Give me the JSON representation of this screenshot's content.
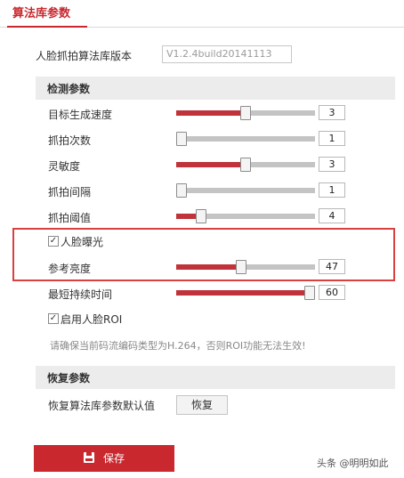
{
  "tab": {
    "label": "算法库参数"
  },
  "version": {
    "label": "人脸抓拍算法库版本",
    "value": "V1.2.4build20141113"
  },
  "detect_section": {
    "title": "检测参数"
  },
  "sliders": [
    {
      "label": "目标生成速度",
      "value": "3",
      "percent": 50
    },
    {
      "label": "抓拍次数",
      "value": "1",
      "percent": 4
    },
    {
      "label": "灵敏度",
      "value": "3",
      "percent": 50
    },
    {
      "label": "抓拍间隔",
      "value": "1",
      "percent": 4
    },
    {
      "label": "抓拍阈值",
      "value": "4",
      "percent": 18
    }
  ],
  "face_exposure": {
    "label": "人脸曝光",
    "checked": true
  },
  "brightness": {
    "label": "参考亮度",
    "value": "47",
    "percent": 47
  },
  "min_duration": {
    "label": "最短持续时间",
    "value": "60",
    "percent": 96
  },
  "face_roi": {
    "label": "启用人脸ROI",
    "checked": true
  },
  "hint": "请确保当前码流编码类型为H.264，否则ROI功能无法生效!",
  "restore_section": {
    "title": "恢复参数",
    "label": "恢复算法库参数默认值",
    "button": "恢复"
  },
  "save_button": "保存",
  "watermark": "头条 @明明如此",
  "colors": {
    "accent": "#c8282e",
    "slider_fill": "#c0333a",
    "highlight_border": "#d94040"
  }
}
